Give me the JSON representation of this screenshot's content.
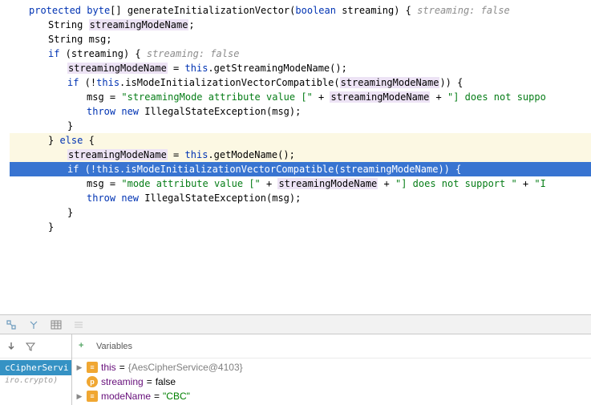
{
  "code": {
    "l1_kw": "protected",
    "l1_type": "byte",
    "l1_method": "generateInitializationVector",
    "l1_paramkw": "boolean",
    "l1_param": "streaming",
    "l1_comment": "streaming: false",
    "l2_type": "String",
    "l2_var": "streamingModeName",
    "l3_type": "String",
    "l3_var": "msg",
    "l4_kw": "if",
    "l4_var": "streaming",
    "l4_comment": "streaming: false",
    "l5_var": "streamingModeName",
    "l5_this": "this",
    "l5_method": "getStreamingModeName",
    "l6_kw": "if",
    "l6_this": "this",
    "l6_method": "isModeInitializationVectorCompatible",
    "l6_arg": "streamingModeName",
    "l7_var": "msg",
    "l7_str1": "\"streamingMode attribute value [\"",
    "l7_var2": "streamingModeName",
    "l7_str2": "\"] does not suppo",
    "l8_kw1": "throw",
    "l8_kw2": "new",
    "l8_type": "IllegalStateException",
    "l8_arg": "msg",
    "l10_kw": "else",
    "l11_var": "streamingModeName",
    "l11_this": "this",
    "l11_method": "getModeName",
    "l12_kw": "if",
    "l12_this": "this",
    "l12_method": "isModeInitializationVectorCompatible",
    "l12_arg": "streamingModeName",
    "l13_var": "msg",
    "l13_str1": "\"mode attribute value [\"",
    "l13_var2": "streamingModeName",
    "l13_str2": "\"] does not support \"",
    "l13_str3": "\"I",
    "l14_kw1": "throw",
    "l14_kw2": "new",
    "l14_type": "IllegalStateException",
    "l14_arg": "msg"
  },
  "debug": {
    "frame_name": "cCipherServi",
    "frame_pkg": "iro.crypto)",
    "vars_title": "Variables",
    "rows": {
      "r1_name": "this",
      "r1_val": "{AesCipherService@4103}",
      "r2_name": "streaming",
      "r2_val": "false",
      "r3_name": "modeName",
      "r3_val": "\"CBC\""
    }
  },
  "chart_data": {
    "type": "table",
    "title": "Debugger Variables",
    "rows": [
      {
        "name": "this",
        "value": "{AesCipherService@4103}"
      },
      {
        "name": "streaming",
        "value": "false"
      },
      {
        "name": "modeName",
        "value": "\"CBC\""
      }
    ]
  }
}
